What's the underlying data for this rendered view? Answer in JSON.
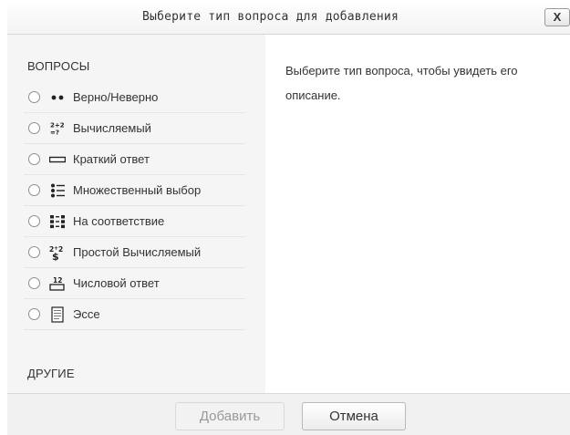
{
  "dialog": {
    "title": "Выберите тип вопроса для добавления",
    "close_label": "X"
  },
  "left": {
    "questions_heading": "ВОПРОСЫ",
    "others_heading": "ДРУГИЕ",
    "questions": [
      {
        "label": "Верно/Неверно",
        "icon": "true-false-icon"
      },
      {
        "label": "Вычисляемый",
        "icon": "calculated-icon"
      },
      {
        "label": "Краткий ответ",
        "icon": "short-answer-icon"
      },
      {
        "label": "Множественный выбор",
        "icon": "multiple-choice-icon"
      },
      {
        "label": "На соответствие",
        "icon": "matching-icon"
      },
      {
        "label": "Простой Вычисляемый",
        "icon": "simple-calculated-icon"
      },
      {
        "label": "Числовой ответ",
        "icon": "numerical-icon"
      },
      {
        "label": "Эссе",
        "icon": "essay-icon"
      }
    ]
  },
  "right": {
    "description": "Выберите тип вопроса, чтобы увидеть его описание."
  },
  "footer": {
    "add_label": "Добавить",
    "cancel_label": "Отмена"
  }
}
